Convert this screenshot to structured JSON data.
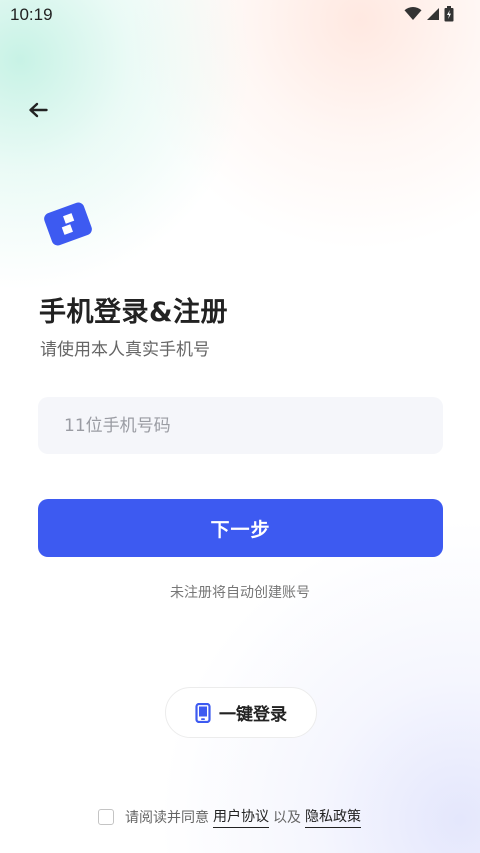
{
  "status_bar": {
    "time": "10:19",
    "icons": [
      "wifi-icon",
      "signal-icon",
      "battery-icon"
    ]
  },
  "header": {
    "back_icon": "arrow-left-icon"
  },
  "logo": {
    "icon": "app-logo-icon",
    "color": "#3d5af1"
  },
  "main": {
    "title": "手机登录&注册",
    "subtitle": "请使用本人真实手机号",
    "phone_input": {
      "value": "",
      "placeholder": "11位手机号码"
    },
    "next_button": "下一步",
    "auto_register_hint": "未注册将自动创建账号"
  },
  "one_key_login": {
    "icon": "phone-icon",
    "label": "一键登录"
  },
  "agreement": {
    "checked": false,
    "prefix": "请阅读并同意",
    "user_agreement": "用户协议",
    "connector": "以及",
    "privacy_policy": "隐私政策"
  },
  "colors": {
    "accent": "#3d5af1",
    "text_primary": "#222222",
    "text_secondary": "#666666",
    "input_bg": "#f5f6fa"
  }
}
